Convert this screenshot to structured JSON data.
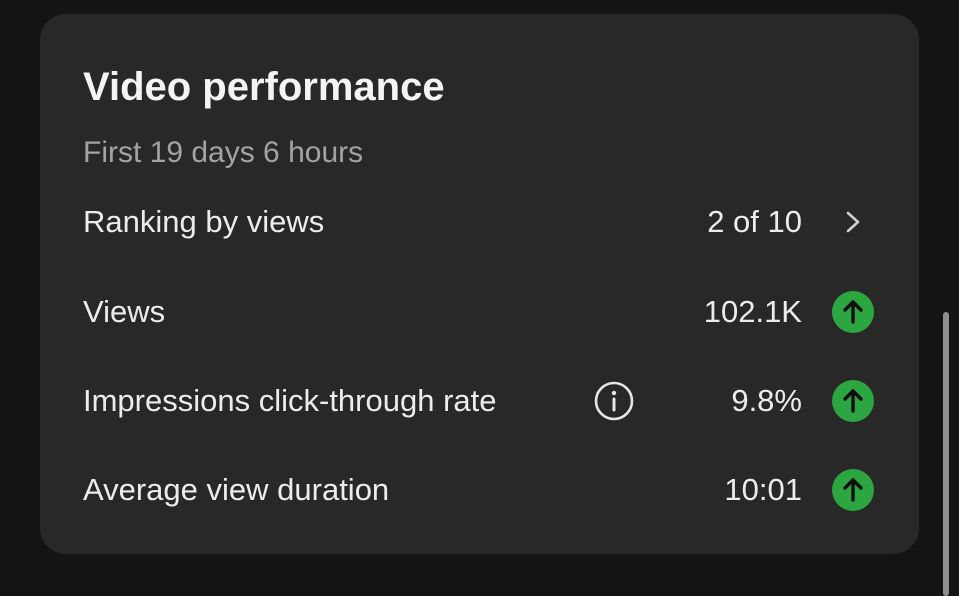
{
  "card": {
    "title": "Video performance",
    "subtitle": "First 19 days 6 hours"
  },
  "rows": [
    {
      "label": "Ranking by views",
      "value": "2 of 10",
      "trailing_icon": "chevron-right-icon"
    },
    {
      "label": "Views",
      "value": "102.1K",
      "trailing_icon": "trend-up-icon"
    },
    {
      "label": "Impressions click-through rate",
      "value": "9.8%",
      "info_icon": "info-icon",
      "trailing_icon": "trend-up-icon"
    },
    {
      "label": "Average view duration",
      "value": "10:01",
      "trailing_icon": "trend-up-icon"
    }
  ],
  "colors": {
    "background": "#141414",
    "card": "#282828",
    "text_primary": "#ececec",
    "text_secondary": "#a3a3a3",
    "trend_up": "#2ba640"
  }
}
